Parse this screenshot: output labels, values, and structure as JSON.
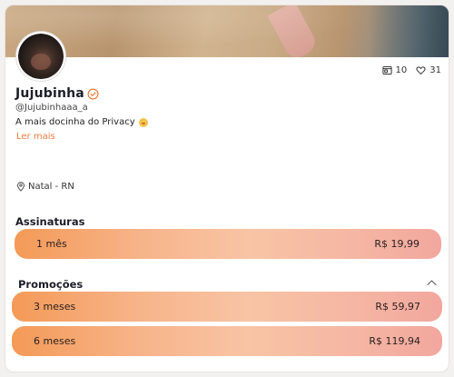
{
  "profile": {
    "name": "Jujubinha",
    "handle": "@Jujubinhaaa_a",
    "bio": "A mais docinha do Privacy",
    "read_more": "Ler mais",
    "location": "Natal - RN"
  },
  "stats": {
    "media_count": "10",
    "likes_count": "31"
  },
  "subscriptions": {
    "title": "Assinaturas",
    "plans": [
      {
        "label": "1 mês",
        "price": "R$ 19,99"
      }
    ]
  },
  "promotions": {
    "title": "Promoções",
    "plans": [
      {
        "label": "3 meses",
        "price": "R$ 59,97"
      },
      {
        "label": "6 meses",
        "price": "R$ 119,94"
      }
    ]
  },
  "colors": {
    "accent": "#f07c3a",
    "gradient_start": "#f49a57",
    "gradient_end": "#f2a79e"
  },
  "icons": [
    "media-icon",
    "heart-icon",
    "verified-icon",
    "location-pin-icon",
    "chevron-up-icon",
    "emoji-icon"
  ]
}
